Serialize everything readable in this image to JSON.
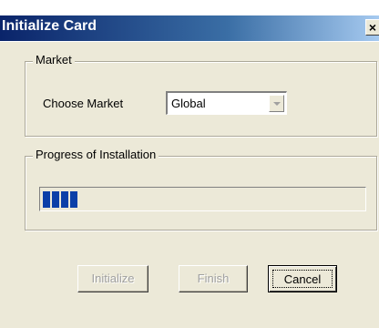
{
  "window": {
    "title": "Initialize Card",
    "close_label": "×"
  },
  "market": {
    "group_label": "Market",
    "choose_label": "Choose Market",
    "select_value": "Global"
  },
  "progress": {
    "group_label": "Progress of Installation",
    "value_fraction": 0.12
  },
  "buttons": {
    "initialize": "Initialize",
    "finish": "Finish",
    "cancel": "Cancel"
  },
  "colors": {
    "title_bar": "#0a246a",
    "window_bg": "#ece9d8",
    "progress_fill": "#0b3fa8"
  },
  "icons": {
    "close": "close-icon",
    "dropdown": "chevron-down-icon"
  }
}
